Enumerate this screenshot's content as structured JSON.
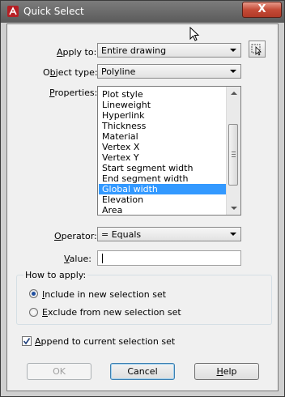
{
  "window": {
    "title": "Quick Select",
    "close_label": "X"
  },
  "labels": {
    "apply_to": [
      "Apply to:",
      "A"
    ],
    "object_type": [
      "Object type:",
      "b"
    ],
    "properties": [
      "Properties:",
      "P"
    ],
    "operator": [
      "Operator:",
      "O"
    ],
    "value": [
      "Value:",
      "V"
    ]
  },
  "apply_to": {
    "value": "Entire drawing"
  },
  "object_type": {
    "value": "Polyline"
  },
  "properties": {
    "items": [
      "Plot style",
      "Lineweight",
      "Hyperlink",
      "Thickness",
      "Material",
      "Vertex X",
      "Vertex Y",
      "Start segment width",
      "End segment width",
      "Global width",
      "Elevation",
      "Area"
    ],
    "selected": "Global width"
  },
  "operator": {
    "value": "= Equals"
  },
  "value": {
    "text": ""
  },
  "how_to_apply": {
    "label": "How to apply:",
    "include": "Include in new selection set",
    "exclude": "Exclude from new selection set",
    "selected": "include"
  },
  "append": {
    "label": "Append to current selection set",
    "checked": true
  },
  "buttons": {
    "ok": "OK",
    "cancel": "Cancel",
    "help": "Help"
  }
}
